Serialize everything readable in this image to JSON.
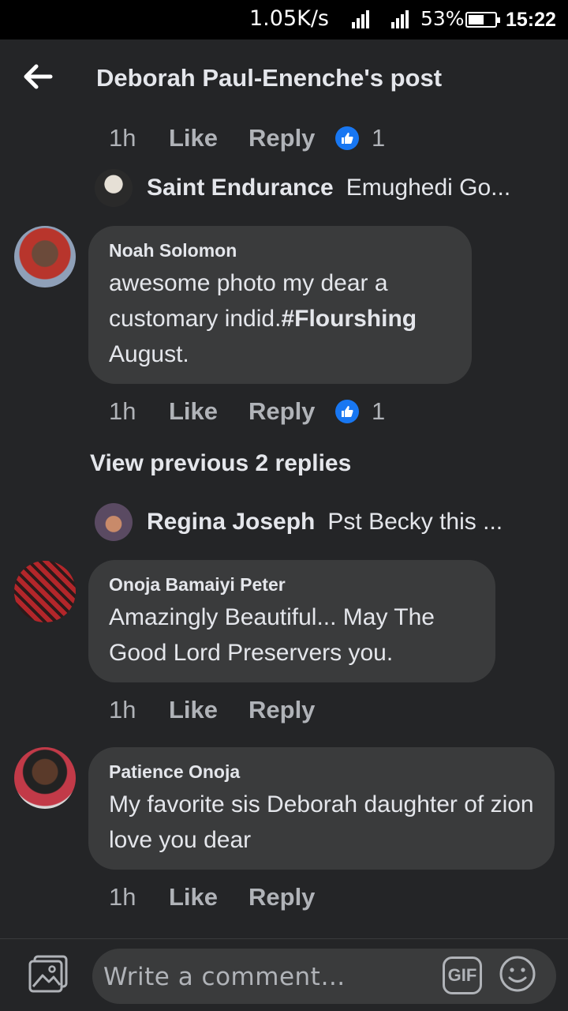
{
  "status_bar": {
    "network_speed": "1.05K/s",
    "battery_percent": "53%",
    "time": "15:22"
  },
  "header": {
    "title": "Deborah Paul-Enenche's post"
  },
  "comments": [
    {
      "meta": {
        "time": "1h",
        "like": "Like",
        "reply": "Reply",
        "reaction_count": "1"
      },
      "reply_preview": {
        "name": "Saint Endurance",
        "snippet": "Emughedi Go..."
      }
    },
    {
      "author": "Noah Solomon",
      "text_plain": "awesome photo my dear a customary indid.",
      "hashtag": "#Flourshing",
      "text_after": "August.",
      "meta": {
        "time": "1h",
        "like": "Like",
        "reply": "Reply",
        "reaction_count": "1"
      },
      "view_previous": "View previous 2 replies",
      "reply_preview": {
        "name": "Regina Joseph",
        "snippet": "Pst Becky this ..."
      }
    },
    {
      "author": "Onoja Bamaiyi Peter",
      "text": "Amazingly Beautiful... May The Good Lord Preservers you.",
      "meta": {
        "time": "1h",
        "like": "Like",
        "reply": "Reply"
      }
    },
    {
      "author": "Patience Onoja",
      "text": "My favorite sis Deborah daughter of zion love you dear",
      "meta": {
        "time": "1h",
        "like": "Like",
        "reply": "Reply"
      }
    }
  ],
  "composer": {
    "placeholder": "Write a comment…",
    "gif_label": "GIF",
    "icons": [
      "photo-icon",
      "gif-icon",
      "emoji-icon"
    ]
  },
  "colors": {
    "background": "#242527",
    "bubble": "#3a3b3c",
    "primary_text": "#e4e6eb",
    "secondary_text": "#b0b3b8",
    "like_blue": "#1877f2"
  }
}
